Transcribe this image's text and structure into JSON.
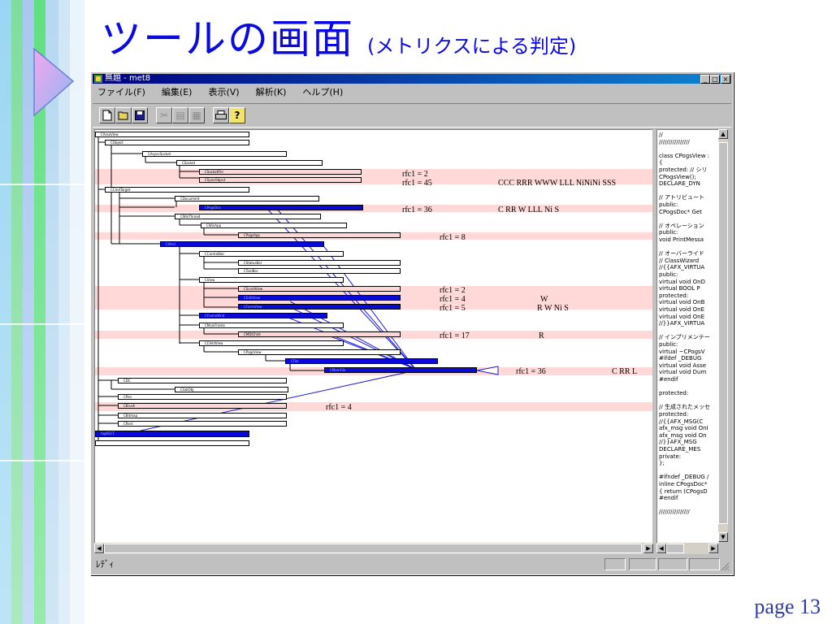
{
  "slide": {
    "title": "ツールの画面",
    "subtitle": "(メトリクスによる判定)",
    "page_number": "page 13"
  },
  "window": {
    "title": "無題 - met8",
    "menu": [
      "ファイル(F)",
      "編集(E)",
      "表示(V)",
      "解析(K)",
      "ヘルプ(H)"
    ],
    "caption_buttons": [
      "_",
      "□",
      "×"
    ],
    "toolbar_icons": [
      "new-file-icon",
      "open-folder-icon",
      "save-icon",
      "cut-icon",
      "copy-icon",
      "paste-icon",
      "print-icon",
      "help-icon"
    ],
    "status": "ﾚﾃﾞｨ"
  },
  "graph": {
    "nodes": [
      {
        "label": "CAssoView"
      },
      {
        "label": "CObject"
      },
      {
        "label": "CAsyncSocket"
      },
      {
        "label": "CSocket"
      },
      {
        "label": "CSocketFile"
      },
      {
        "label": "CSyncObject"
      },
      {
        "label": "CCmdTarget"
      },
      {
        "label": "CDocument"
      },
      {
        "label": "CPogsDoc"
      },
      {
        "label": "CWinThread"
      },
      {
        "label": "CWinApp"
      },
      {
        "label": "CPogsApp"
      },
      {
        "label": "CWnd"
      },
      {
        "label": "CControlBar"
      },
      {
        "label": "CStatusBar"
      },
      {
        "label": "CToolBar"
      },
      {
        "label": "CView"
      },
      {
        "label": "CScrollView"
      },
      {
        "label": "CEditView"
      },
      {
        "label": "CFormView"
      },
      {
        "label": "CFrameWnd"
      },
      {
        "label": "CMainFrame"
      },
      {
        "label": "CMDIChild"
      },
      {
        "label": "CChildView"
      },
      {
        "label": "CPogsView"
      },
      {
        "label": "CFile"
      },
      {
        "label": "CMemFile"
      },
      {
        "label": "CDC"
      },
      {
        "label": "CGdiObj"
      },
      {
        "label": "CPen"
      },
      {
        "label": "CBrush"
      },
      {
        "label": "CBitmap"
      },
      {
        "label": "CRect"
      },
      {
        "label": "tagRECT"
      }
    ],
    "metrics": [
      {
        "label": "rfc1 = 2",
        "flags": ""
      },
      {
        "label": "rfc1 = 45",
        "flags": "CCC RRR WWW LLL  NiNiNi SSS"
      },
      {
        "label": "rfc1 = 36",
        "flags": "C RR W LLL   Ni S"
      },
      {
        "label": "rfc1 = 8",
        "flags": ""
      },
      {
        "label": "rfc1 = 2",
        "flags": ""
      },
      {
        "label": "rfc1 = 4",
        "flags": "W"
      },
      {
        "label": "rfc1 = 5",
        "flags": "R W    Ni S"
      },
      {
        "label": "rfc1 = 17",
        "flags": "R"
      },
      {
        "label": "rfc1 = 36",
        "flags": "C RR  L"
      },
      {
        "label": "rfc1 = 4",
        "flags": ""
      }
    ]
  },
  "code_pane": {
    "lines": [
      "//",
      "////////////////",
      "",
      "class CPogsView :",
      "{",
      "protected: // シリ",
      "  CPogsView();",
      "  DECLARE_DYN",
      "",
      "// アトリビュート",
      "public:",
      "  CPogsDoc* Get",
      "",
      "// オペレーション",
      "public:",
      "  void PrintMessa",
      "",
      "// オーバーライド",
      "  // ClassWizard",
      "  //{{AFX_VIRTUA",
      "  public:",
      "  virtual void OnD",
      "  virtual BOOL P",
      "  protected:",
      "  virtual void OnB",
      "  virtual void OnE",
      "  virtual void OnE",
      "  //}}AFX_VIRTUA",
      "",
      "// インプリメンテー",
      "public:",
      "  virtual ~CPogsV",
      "#ifdef _DEBUG",
      "  virtual void Asse",
      "  virtual void Dum",
      "#endif",
      "",
      "protected:",
      "",
      "// 生成されたメッセ",
      "protected:",
      "  //{{AFX_MSG(C",
      "  afx_msg void OnI",
      "  afx_msg void On",
      "  //}}AFX_MSG",
      "  DECLARE_MES",
      "private:",
      "};",
      "",
      "#ifndef _DEBUG  /",
      "inline CPogsDoc*",
      "  { return (CPogsD",
      "#endif",
      "",
      "////////////////"
    ]
  }
}
